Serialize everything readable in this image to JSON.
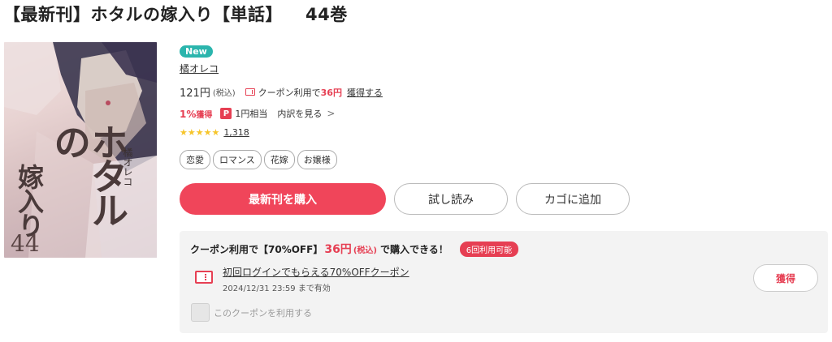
{
  "title": {
    "main": "【最新刊】ホタルの嫁入り【単話】",
    "volume": "44巻"
  },
  "cover": {
    "title_vertical": "ホタルの",
    "subtitle_vertical": "嫁入り",
    "number": "44",
    "author_vertical": "橘オレコ"
  },
  "product": {
    "badge": "New",
    "author": "橘オレコ",
    "price": "121円",
    "tax": "(税込)",
    "coupon_text": "クーポン利用で",
    "coupon_price": "36円",
    "coupon_get": "獲得する",
    "points_pct": "1%",
    "points_label": "獲得",
    "pp_icon_text": "P",
    "points_yen": "1円相当",
    "points_detail": "内訳を見る",
    "rating_stars": "★★★★★",
    "rating_count": "1,318",
    "tags": [
      "恋愛",
      "ロマンス",
      "花嫁",
      "お嬢様"
    ]
  },
  "buttons": {
    "buy": "最新刊を購入",
    "trial": "試し読み",
    "cart": "カゴに追加"
  },
  "coupon_box": {
    "headline_pre": "クーポン利用で【70%OFF】",
    "headline_price": "36円",
    "headline_tax": "(税込)",
    "headline_post": "で購入できる！",
    "uses": "6回利用可能",
    "coupon_name": "初回ログインでもらえる70%OFFクーポン",
    "valid_until": "2024/12/31 23:59 まで有効",
    "get_button": "獲得",
    "checkbox_label": "このクーポンを利用する"
  },
  "colors": {
    "accent": "#f0455a",
    "new_badge": "#2bb5ad",
    "star": "#f6c52a"
  }
}
